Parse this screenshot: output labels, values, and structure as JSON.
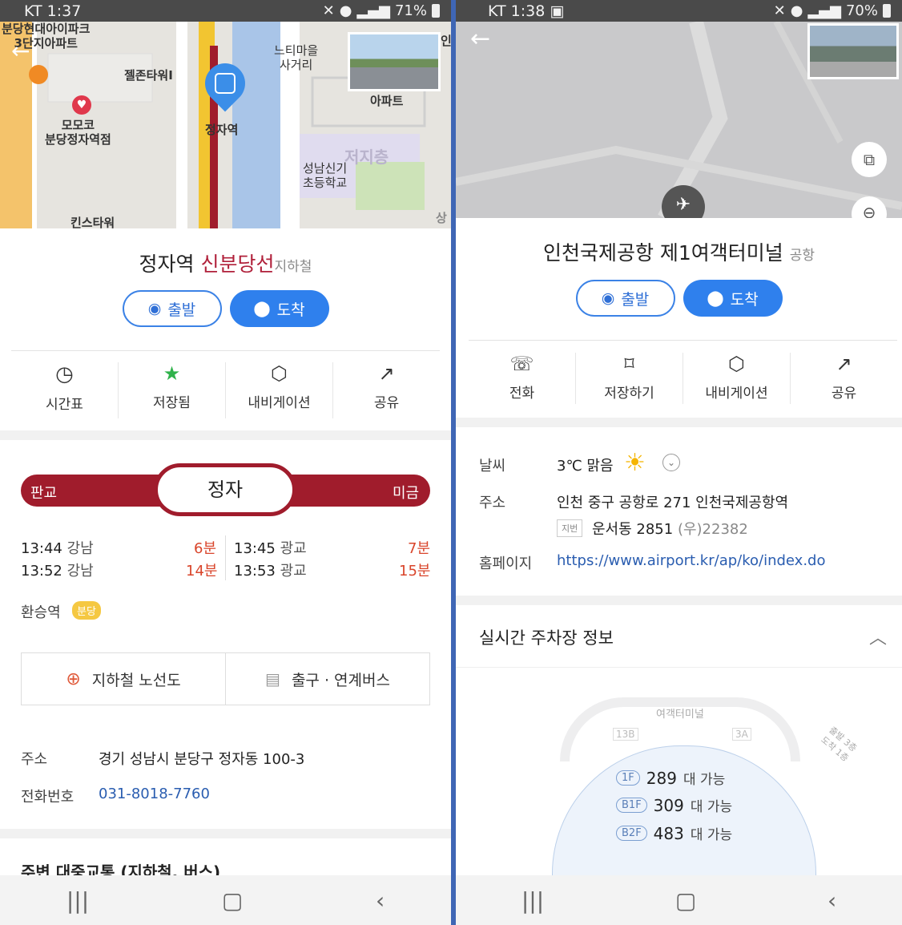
{
  "left": {
    "status": {
      "carrier": "KT",
      "time": "1:37",
      "battery": "71%"
    },
    "map_labels": {
      "a": "분당현대아이파크\n3단지아파트",
      "b": "젤존타워I",
      "c": "느티마을\n사거리",
      "d": "모모코\n분당정자역점",
      "e": "정자역",
      "f": "아파트",
      "g": "성남신기\n초등학교",
      "h": "킨스타워",
      "i": "저지층",
      "j": "상",
      "k": "인"
    },
    "title": {
      "name": "정자역",
      "line": "신분당선",
      "type": "지하철"
    },
    "buttons": {
      "depart": "출발",
      "arrive": "도착"
    },
    "actions": [
      {
        "label": "시간표",
        "icon": "clock-icon"
      },
      {
        "label": "저장됨",
        "icon": "bookmark-icon"
      },
      {
        "label": "내비게이션",
        "icon": "navigation-icon"
      },
      {
        "label": "공유",
        "icon": "share-icon"
      }
    ],
    "line_bar": {
      "prev": "판교",
      "current": "정자",
      "next": "미금",
      "color": "#a01c2c"
    },
    "departures": [
      {
        "time": "13:44",
        "dest": "강남",
        "mins": "6분"
      },
      {
        "time": "13:52",
        "dest": "강남",
        "mins": "14분"
      },
      {
        "time": "13:45",
        "dest": "광교",
        "mins": "7분"
      },
      {
        "time": "13:53",
        "dest": "광교",
        "mins": "15분"
      }
    ],
    "transfer": {
      "label": "환승역",
      "badge": "분당"
    },
    "links": {
      "route_map": "지하철 노선도",
      "exit_bus": "출구 · 연계버스"
    },
    "address": {
      "label": "주소",
      "value": "경기 성남시 분당구 정자동 100-3"
    },
    "phone": {
      "label": "전화번호",
      "value": "031-8018-7760"
    },
    "nearby": "주변 대중교통 (지하철, 버스)"
  },
  "right": {
    "status": {
      "carrier": "KT",
      "time": "1:38",
      "battery": "70%"
    },
    "title": {
      "name": "인천국제공항 제1여객터미널",
      "type": "공항"
    },
    "buttons": {
      "depart": "출발",
      "arrive": "도착"
    },
    "actions": [
      {
        "label": "전화",
        "icon": "phone-icon"
      },
      {
        "label": "저장하기",
        "icon": "bookmark-icon"
      },
      {
        "label": "내비게이션",
        "icon": "navigation-icon"
      },
      {
        "label": "공유",
        "icon": "share-icon"
      }
    ],
    "weather": {
      "label": "날씨",
      "value": "3℃ 맑음"
    },
    "address": {
      "label": "주소",
      "value": "인천 중구 공항로 271 인천국제공항역",
      "jibun_tag": "지번",
      "jibun": "운서동 2851",
      "postal": "(우)22382"
    },
    "homepage": {
      "label": "홈페이지",
      "value": "https://www.airport.kr/ap/ko/index.do"
    },
    "parking": {
      "title": "실시간 주차장 정보",
      "terminal": "여객터미널",
      "gate_left": "13B",
      "gate_right": "3A",
      "side_note": "출발 3층\n도착 1층",
      "floors": [
        {
          "floor": "1F",
          "count": "289",
          "unit": "대 가능"
        },
        {
          "floor": "B1F",
          "count": "309",
          "unit": "대 가능"
        },
        {
          "floor": "B2F",
          "count": "483",
          "unit": "대 가능"
        }
      ]
    }
  },
  "colors": {
    "accent": "#2f80ed",
    "line": "#a01c2c",
    "mins": "#d9452b",
    "link": "#2a5db0"
  }
}
